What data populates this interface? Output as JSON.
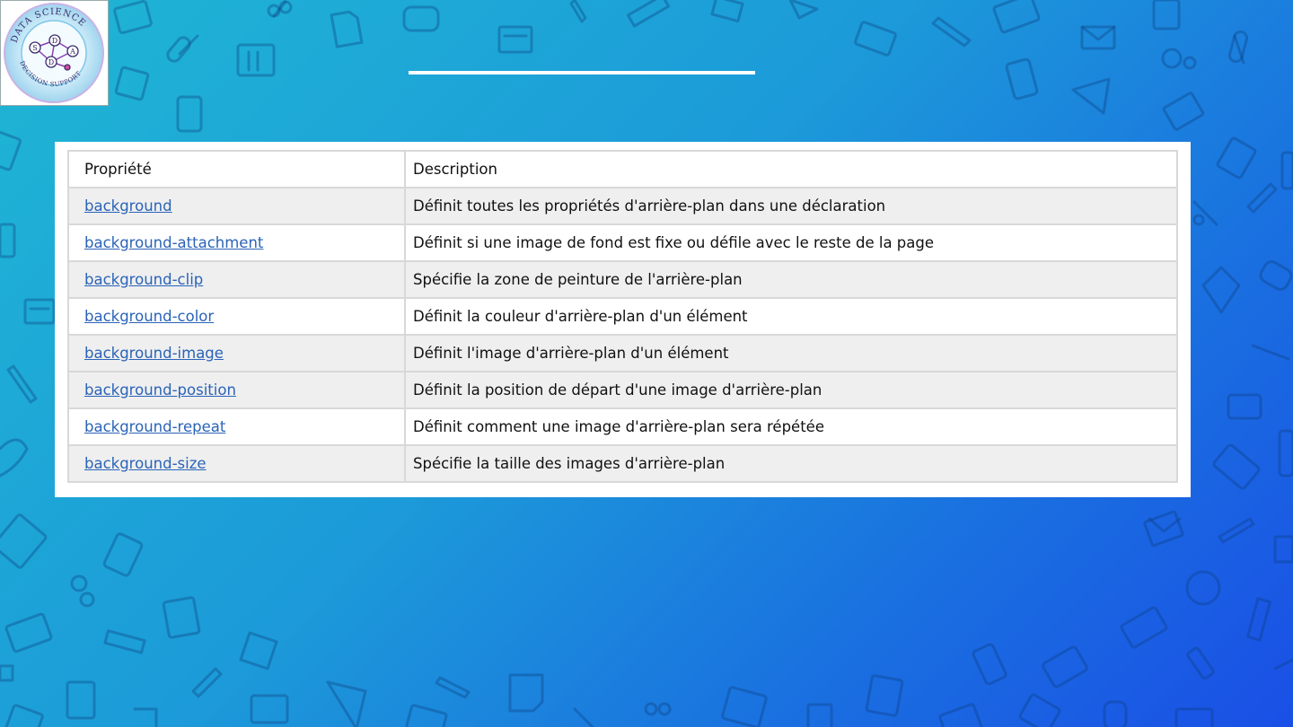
{
  "logo": {
    "ring_text": "DATA SCIENCE",
    "bottom_text": "DECISION SUPPORT",
    "letters": [
      "S",
      "D",
      "D",
      "A"
    ]
  },
  "table": {
    "headers": [
      "Propriété",
      "Description"
    ],
    "rows": [
      {
        "property": "background",
        "description": "Définit toutes les propriétés d'arrière-plan dans une déclaration"
      },
      {
        "property": "background-attachment",
        "description": "Définit si une image de fond est fixe ou défile avec le reste de la page"
      },
      {
        "property": "background-clip",
        "description": "Spécifie la zone de peinture de l'arrière-plan"
      },
      {
        "property": "background-color",
        "description": "Définit la couleur d'arrière-plan d'un élément"
      },
      {
        "property": "background-image",
        "description": "Définit l'image d'arrière-plan d'un élément"
      },
      {
        "property": "background-position",
        "description": "Définit la position de départ d'une image d'arrière-plan"
      },
      {
        "property": "background-repeat",
        "description": "Définit comment une image d'arrière-plan sera répétée"
      },
      {
        "property": "background-size",
        "description": "Spécifie la taille des images d'arrière-plan"
      }
    ]
  },
  "colors": {
    "link": "#2a63b8",
    "row_alt": "#efefef",
    "background_start": "#1fb6d4",
    "background_end": "#1a4fe6"
  }
}
